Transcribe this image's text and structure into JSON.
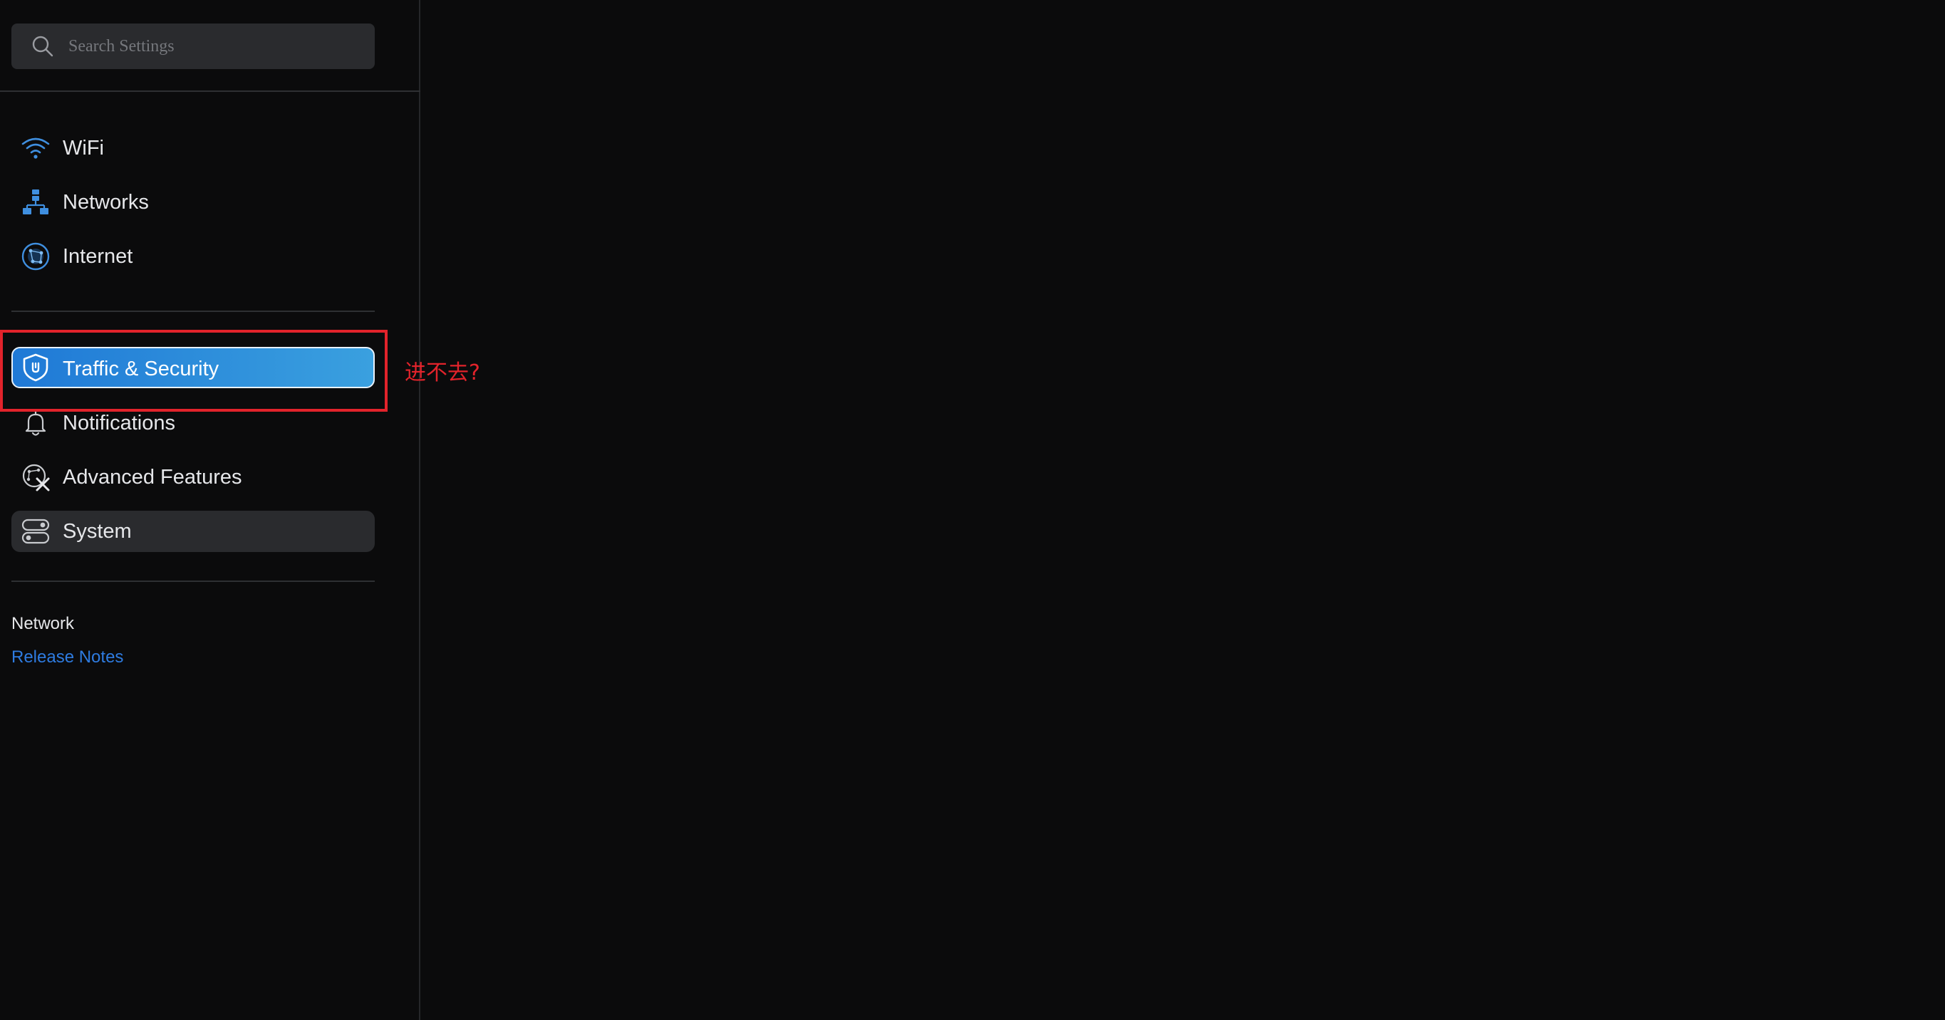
{
  "search": {
    "placeholder": "Search Settings",
    "value": ""
  },
  "sidebar": {
    "items": [
      {
        "label": "WiFi",
        "icon": "wifi-icon"
      },
      {
        "label": "Networks",
        "icon": "network-topology-icon"
      },
      {
        "label": "Internet",
        "icon": "globe-icon"
      },
      {
        "label": "Traffic & Security",
        "icon": "shield-icon",
        "state": "active"
      },
      {
        "label": "Notifications",
        "icon": "bell-icon"
      },
      {
        "label": "Advanced Features",
        "icon": "tools-icon"
      },
      {
        "label": "System",
        "icon": "server-toggle-icon",
        "state": "hover"
      }
    ],
    "footer": {
      "title": "Network",
      "link_label": "Release Notes"
    }
  },
  "annotation": {
    "text": "进不去?"
  },
  "colors": {
    "background": "#0b0b0c",
    "accent": "#1f79d6",
    "accent_light": "#3aa0df",
    "link": "#2e7be0",
    "annotation_red": "#e2232b",
    "hover_bg": "#2a2b2e"
  }
}
